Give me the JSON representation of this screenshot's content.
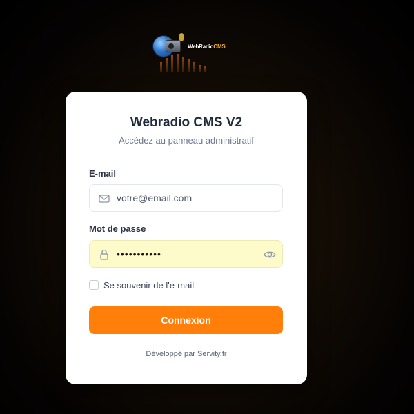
{
  "logo": {
    "text_main": "WebRadio",
    "text_accent": "CMS"
  },
  "login": {
    "title": "Webradio CMS V2",
    "subtitle": "Accédez au panneau administratif",
    "email_label": "E-mail",
    "email_placeholder": "votre@email.com",
    "email_value": "",
    "password_label": "Mot de passe",
    "password_value": "•••••••••••",
    "remember_label": "Se souvenir de l'e-mail",
    "remember_checked": false,
    "submit_label": "Connexion",
    "footer": "Développé par Servity.fr"
  },
  "icons": {
    "email": "envelope-icon",
    "password": "lock-icon",
    "toggle_visibility": "eye-icon"
  },
  "colors": {
    "accent": "#ff7f0a",
    "password_fill": "#fdfbc9",
    "title": "#1f2a3c"
  }
}
